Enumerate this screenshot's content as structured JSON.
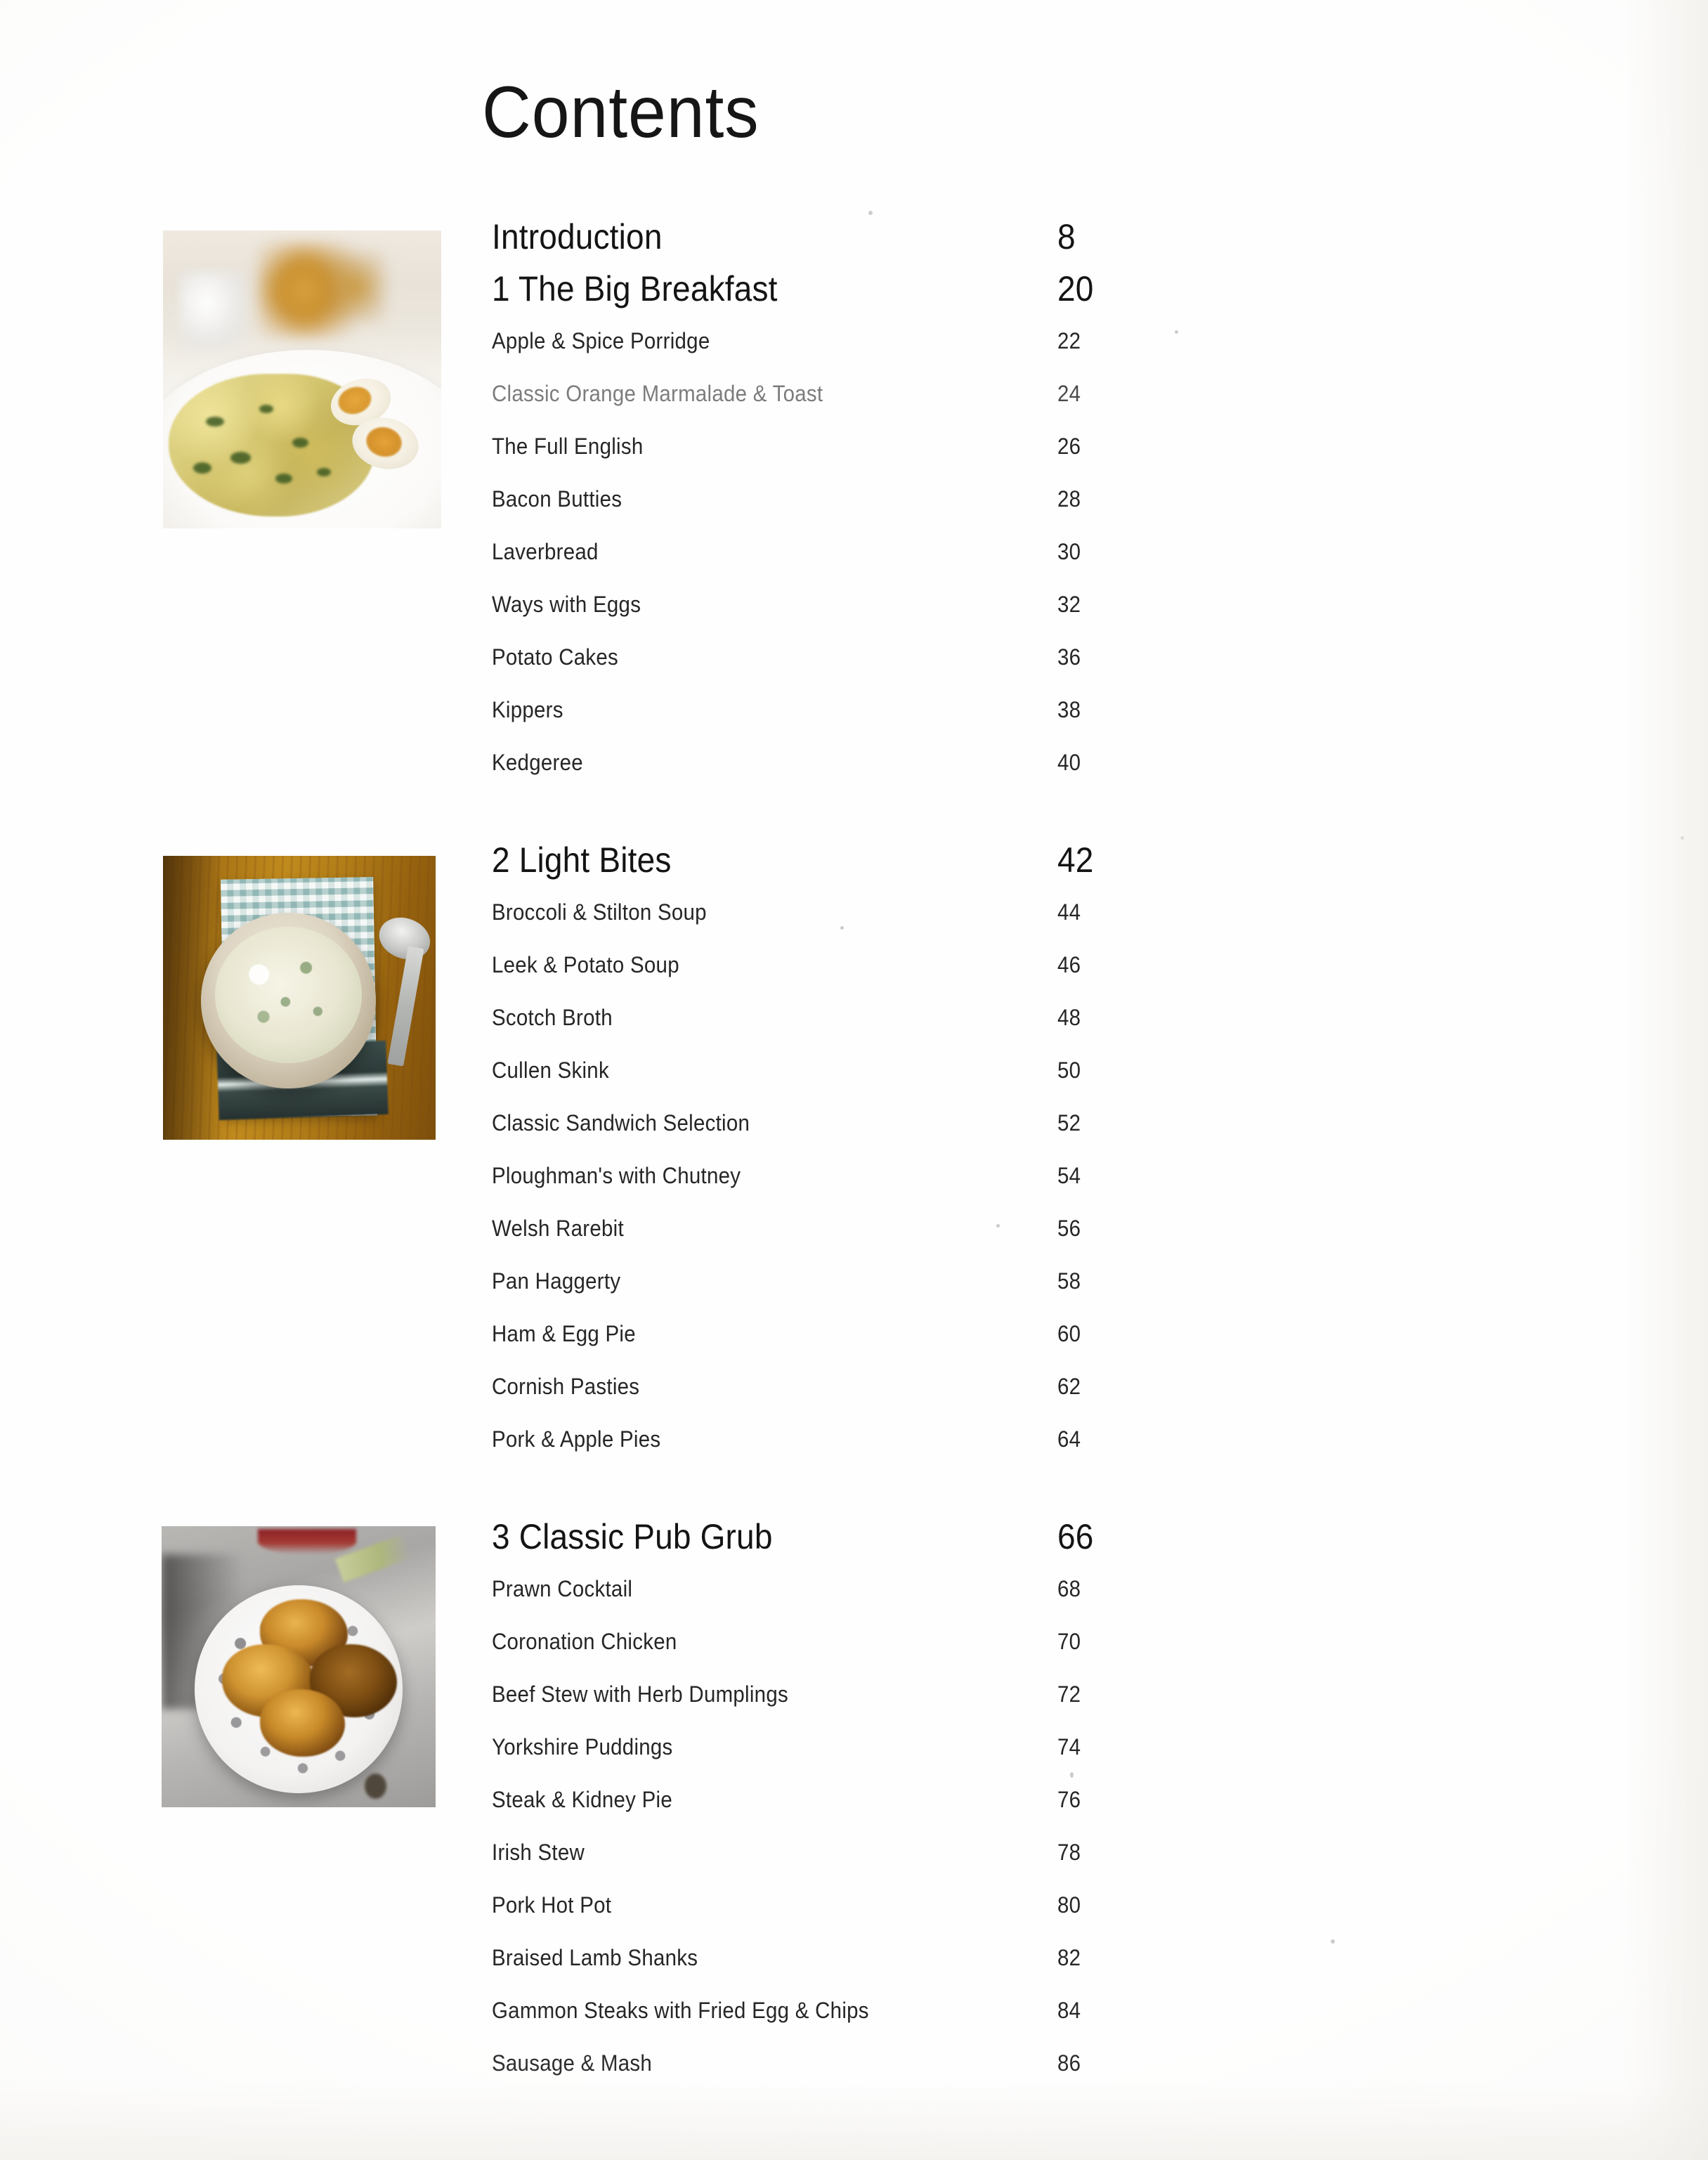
{
  "page": {
    "title": "Contents",
    "background_color": "#fefefe",
    "text_color": "#1a1a1a"
  },
  "toc": {
    "intro": {
      "label": "Introduction",
      "page": "8"
    },
    "sections": [
      {
        "heading": "1 The Big Breakfast",
        "heading_page": "20",
        "photo_alt": "kedgeree-with-egg-on-white-plate",
        "items": [
          {
            "label": "Apple & Spice Porridge",
            "page": "22",
            "faded": false
          },
          {
            "label": "Classic Orange Marmalade & Toast",
            "page": "24",
            "faded": true
          },
          {
            "label": "The Full English",
            "page": "26",
            "faded": false
          },
          {
            "label": "Bacon Butties",
            "page": "28",
            "faded": false
          },
          {
            "label": "Laverbread",
            "page": "30",
            "faded": false
          },
          {
            "label": "Ways with Eggs",
            "page": "32",
            "faded": false
          },
          {
            "label": "Potato Cakes",
            "page": "36",
            "faded": false
          },
          {
            "label": "Kippers",
            "page": "38",
            "faded": false
          },
          {
            "label": "Kedgeree",
            "page": "40",
            "faded": false
          }
        ]
      },
      {
        "heading": "2 Light Bites",
        "heading_page": "42",
        "photo_alt": "creamy-soup-bowl-on-wooden-board",
        "items": [
          {
            "label": "Broccoli & Stilton Soup",
            "page": "44",
            "faded": false
          },
          {
            "label": "Leek & Potato Soup",
            "page": "46",
            "faded": false
          },
          {
            "label": "Scotch Broth",
            "page": "48",
            "faded": false
          },
          {
            "label": "Cullen Skink",
            "page": "50",
            "faded": false
          },
          {
            "label": "Classic Sandwich Selection",
            "page": "52",
            "faded": false
          },
          {
            "label": "Ploughman's with Chutney",
            "page": "54",
            "faded": false
          },
          {
            "label": "Welsh Rarebit",
            "page": "56",
            "faded": false
          },
          {
            "label": "Pan Haggerty",
            "page": "58",
            "faded": false
          },
          {
            "label": "Ham & Egg Pie",
            "page": "60",
            "faded": false
          },
          {
            "label": "Cornish Pasties",
            "page": "62",
            "faded": false
          },
          {
            "label": "Pork & Apple Pies",
            "page": "64",
            "faded": false
          }
        ]
      },
      {
        "heading": "3 Classic Pub Grub",
        "heading_page": "66",
        "photo_alt": "yorkshire-puddings-on-polka-dot-plate",
        "items": [
          {
            "label": "Prawn Cocktail",
            "page": "68",
            "faded": false
          },
          {
            "label": "Coronation Chicken",
            "page": "70",
            "faded": false
          },
          {
            "label": "Beef Stew with Herb Dumplings",
            "page": "72",
            "faded": false
          },
          {
            "label": "Yorkshire Puddings",
            "page": "74",
            "faded": false
          },
          {
            "label": "Steak & Kidney Pie",
            "page": "76",
            "faded": false
          },
          {
            "label": "Irish Stew",
            "page": "78",
            "faded": false
          },
          {
            "label": "Pork Hot Pot",
            "page": "80",
            "faded": false
          },
          {
            "label": "Braised Lamb Shanks",
            "page": "82",
            "faded": false
          },
          {
            "label": "Gammon Steaks with Fried Egg & Chips",
            "page": "84",
            "faded": false
          },
          {
            "label": "Sausage & Mash",
            "page": "86",
            "faded": false
          }
        ]
      }
    ]
  }
}
